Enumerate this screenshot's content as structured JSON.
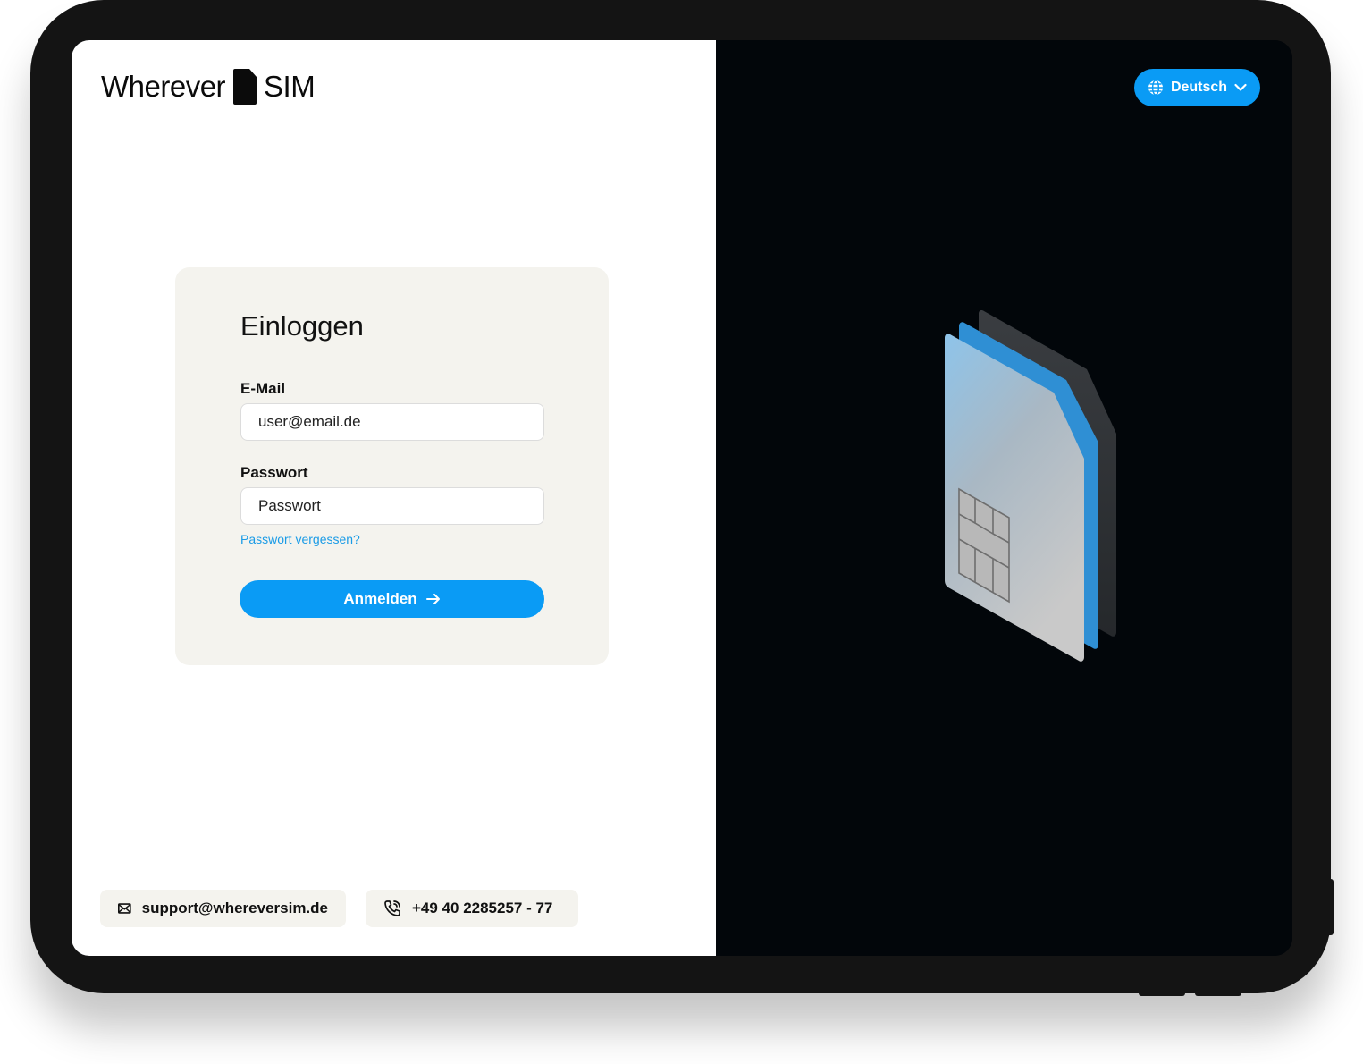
{
  "brand": {
    "name_left": "Wherever",
    "name_right": "SIM"
  },
  "language": {
    "selected": "Deutsch",
    "icon": "globe-icon"
  },
  "login": {
    "title": "Einloggen",
    "email_label": "E-Mail",
    "email_placeholder": "user@email.de",
    "password_label": "Passwort",
    "password_placeholder": "Passwort",
    "forgot_link": "Passwort vergessen?",
    "submit_label": "Anmelden"
  },
  "contact": {
    "email": "support@whereversim.de",
    "phone": "+49 40 2285257 - 77"
  },
  "colors": {
    "accent": "#0a9bf5",
    "card_bg": "#f4f3ee",
    "dark_pane": "#02060a"
  }
}
